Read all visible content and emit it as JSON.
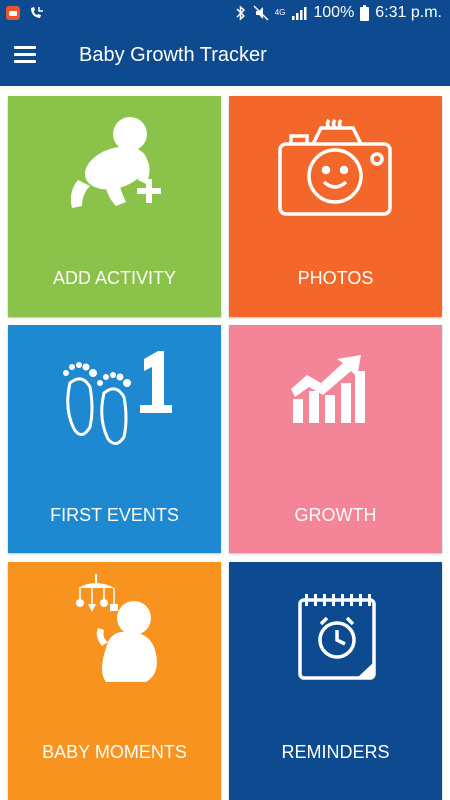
{
  "status_bar": {
    "network": "4G",
    "battery": "100%",
    "time": "6:31 p.m."
  },
  "app_bar": {
    "title": "Baby Growth Tracker"
  },
  "tiles": [
    {
      "label": "ADD ACTIVITY",
      "icon": "crawling-baby-plus-icon",
      "color": "#8bc34a"
    },
    {
      "label": "PHOTOS",
      "icon": "camera-baby-face-icon",
      "color": "#f4672a"
    },
    {
      "label": "FIRST EVENTS",
      "icon": "baby-feet-one-icon",
      "color": "#1e88d0"
    },
    {
      "label": "GROWTH",
      "icon": "growth-chart-icon",
      "color": "#f48497"
    },
    {
      "label": "BABY MOMENTS",
      "icon": "baby-mobile-icon",
      "color": "#f7931e"
    },
    {
      "label": "REMINDERS",
      "icon": "calendar-alarm-icon",
      "color": "#0d4a8f"
    }
  ]
}
